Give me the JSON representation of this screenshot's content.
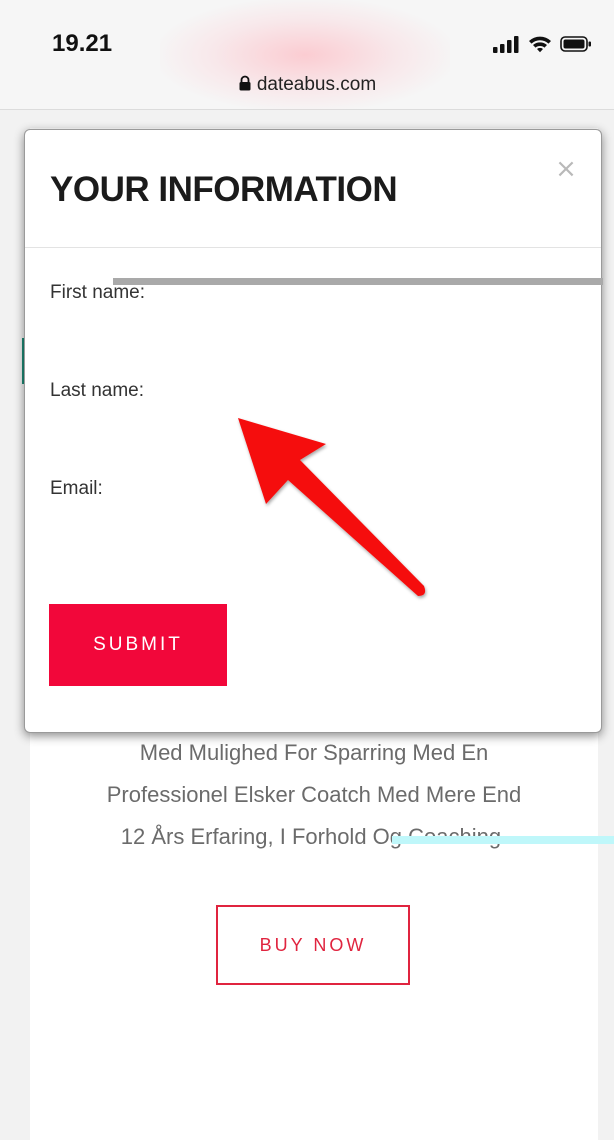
{
  "status_bar": {
    "time": "19.21",
    "icons": [
      "signal-icon",
      "wifi-icon",
      "battery-icon"
    ]
  },
  "browser": {
    "url": "dateabus.com",
    "icon": "lock-icon"
  },
  "modal": {
    "title": "YOUR INFORMATION",
    "close_label": "×",
    "fields": [
      {
        "label": "First name:",
        "value": "",
        "placeholder": ""
      },
      {
        "label": "Last name:",
        "value": "",
        "placeholder": ""
      },
      {
        "label": "Email:",
        "value": "",
        "placeholder": ""
      }
    ],
    "submit_label": "SUBMIT"
  },
  "page": {
    "description_lines": [
      "Med Mulighed For Sparring Med En",
      "Professionel Elsker Coatch Med Mere End",
      "12 Års Erfaring, I Forhold Og Coaching."
    ],
    "buy_label": "BUY NOW"
  },
  "annotation": {
    "icon": "red-arrow-icon"
  },
  "colors": {
    "accent_red": "#f2073a",
    "outline_red": "#e0243f",
    "text_gray": "#6b6b6b",
    "teal_accent": "#1d8a76"
  }
}
